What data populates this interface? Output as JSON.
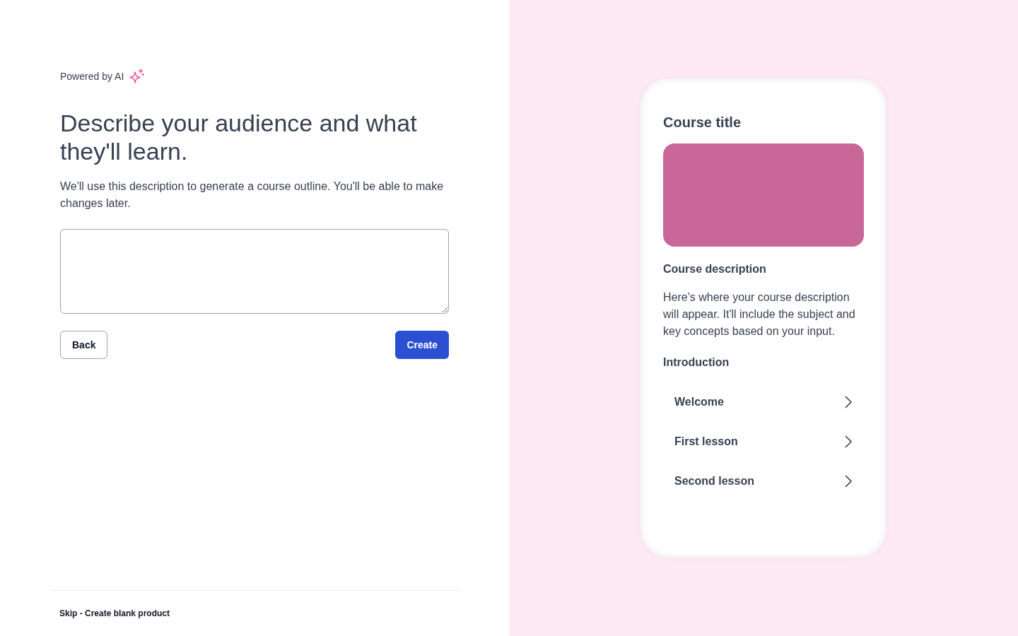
{
  "header": {
    "powered_by": "Powered by AI"
  },
  "heading": "Describe your audience and what they'll learn.",
  "subtitle": "We'll use this description to generate a course outline. You'll be able to make changes later.",
  "buttons": [
    {
      "label": "Back",
      "kind": "secondary"
    },
    {
      "label": "Create",
      "kind": "primary"
    }
  ],
  "footer": {
    "link": "Skip - Create blank product"
  },
  "preview": {
    "title": "Course title",
    "description_heading": "Course description",
    "description": "Here's where your course description will appear. It'll include the subject and key concepts based on your input.",
    "section": "Introduction",
    "lessons": [
      {
        "label": "Welcome"
      },
      {
        "label": "First lesson"
      },
      {
        "label": "Second lesson"
      }
    ]
  }
}
